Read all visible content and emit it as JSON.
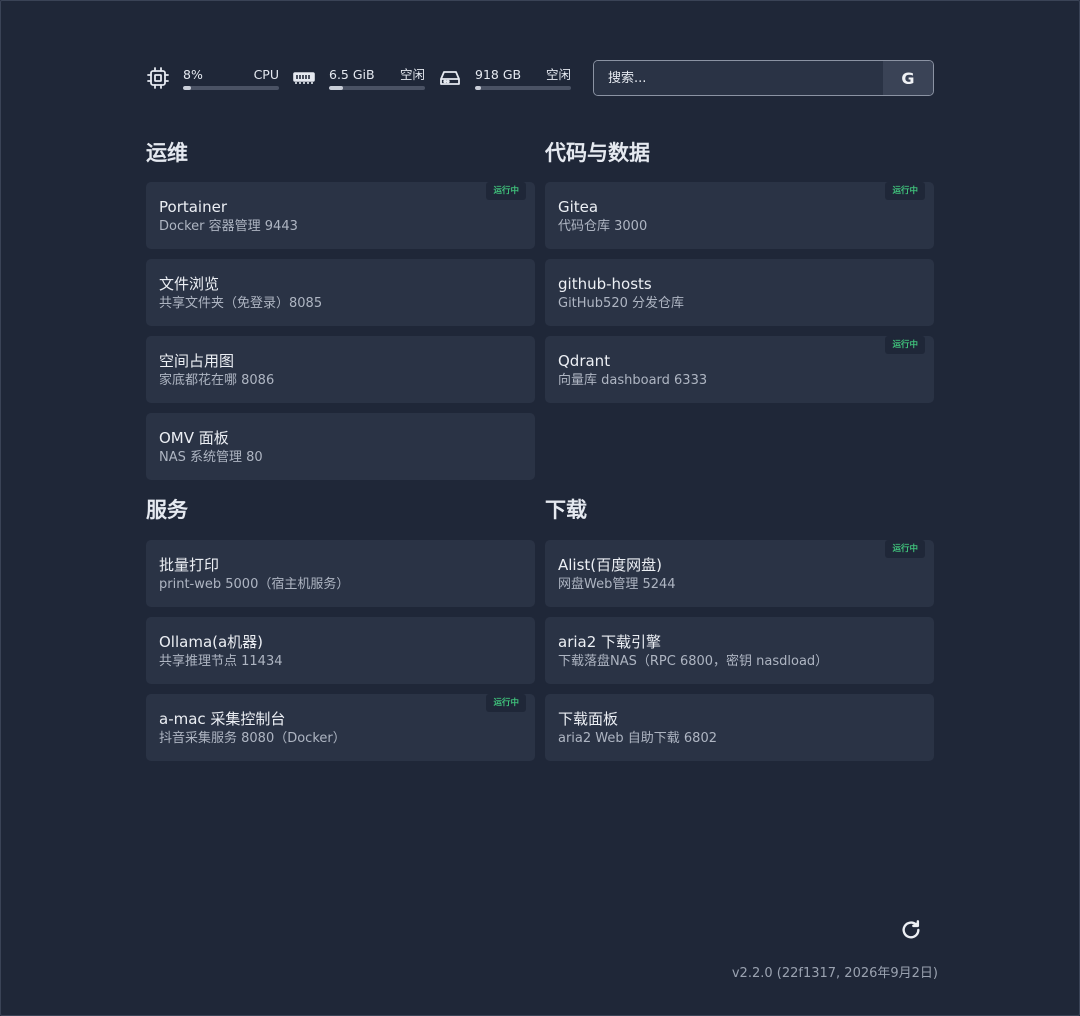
{
  "stats": {
    "cpu": {
      "value": "8%",
      "label": "CPU",
      "usage_fraction": 0.08,
      "icon": "cpu-icon"
    },
    "memory": {
      "value": "6.5 GiB",
      "label": "空闲",
      "usage_fraction": 0.15,
      "icon": "memory-icon"
    },
    "disk": {
      "value": "918 GB",
      "label": "空闲",
      "usage_fraction": 0.06,
      "icon": "disk-icon"
    }
  },
  "search": {
    "placeholder": "搜索...",
    "button_label": "G"
  },
  "sections": {
    "ops": {
      "title": "运维",
      "items": [
        {
          "title": "Portainer",
          "subtitle": "Docker 容器管理 9443",
          "badge": "运行中"
        },
        {
          "title": "文件浏览",
          "subtitle": "共享文件夹（免登录）8085"
        },
        {
          "title": "空间占用图",
          "subtitle": "家底都花在哪 8086"
        },
        {
          "title": "OMV 面板",
          "subtitle": "NAS 系统管理 80"
        }
      ]
    },
    "code": {
      "title": "代码与数据",
      "items": [
        {
          "title": "Gitea",
          "subtitle": "代码仓库 3000",
          "badge": "运行中"
        },
        {
          "title": "github-hosts",
          "subtitle": "GitHub520 分发仓库"
        },
        {
          "title": "Qdrant",
          "subtitle": "向量库 dashboard 6333",
          "badge": "运行中"
        }
      ]
    },
    "services": {
      "title": "服务",
      "items": [
        {
          "title": "批量打印",
          "subtitle": "print-web 5000（宿主机服务）"
        },
        {
          "title": "Ollama(a机器)",
          "subtitle": "共享推理节点 11434"
        },
        {
          "title": "a-mac 采集控制台",
          "subtitle": "抖音采集服务 8080（Docker）",
          "badge": "运行中"
        }
      ]
    },
    "downloads": {
      "title": "下载",
      "items": [
        {
          "title": "Alist(百度网盘)",
          "subtitle": "网盘Web管理 5244",
          "badge": "运行中"
        },
        {
          "title": "aria2 下载引擎",
          "subtitle": "下载落盘NAS（RPC 6800，密钥 nasdload）"
        },
        {
          "title": "下载面板",
          "subtitle": "aria2 Web 自助下载 6802"
        }
      ]
    }
  },
  "footer": {
    "refresh_icon": "refresh-icon",
    "version": "v2.2.0 (22f1317, 2026年9月2日)"
  },
  "colors": {
    "background": "#1f2738",
    "card": "#2a3345",
    "badge_text": "#3fbf7a"
  }
}
